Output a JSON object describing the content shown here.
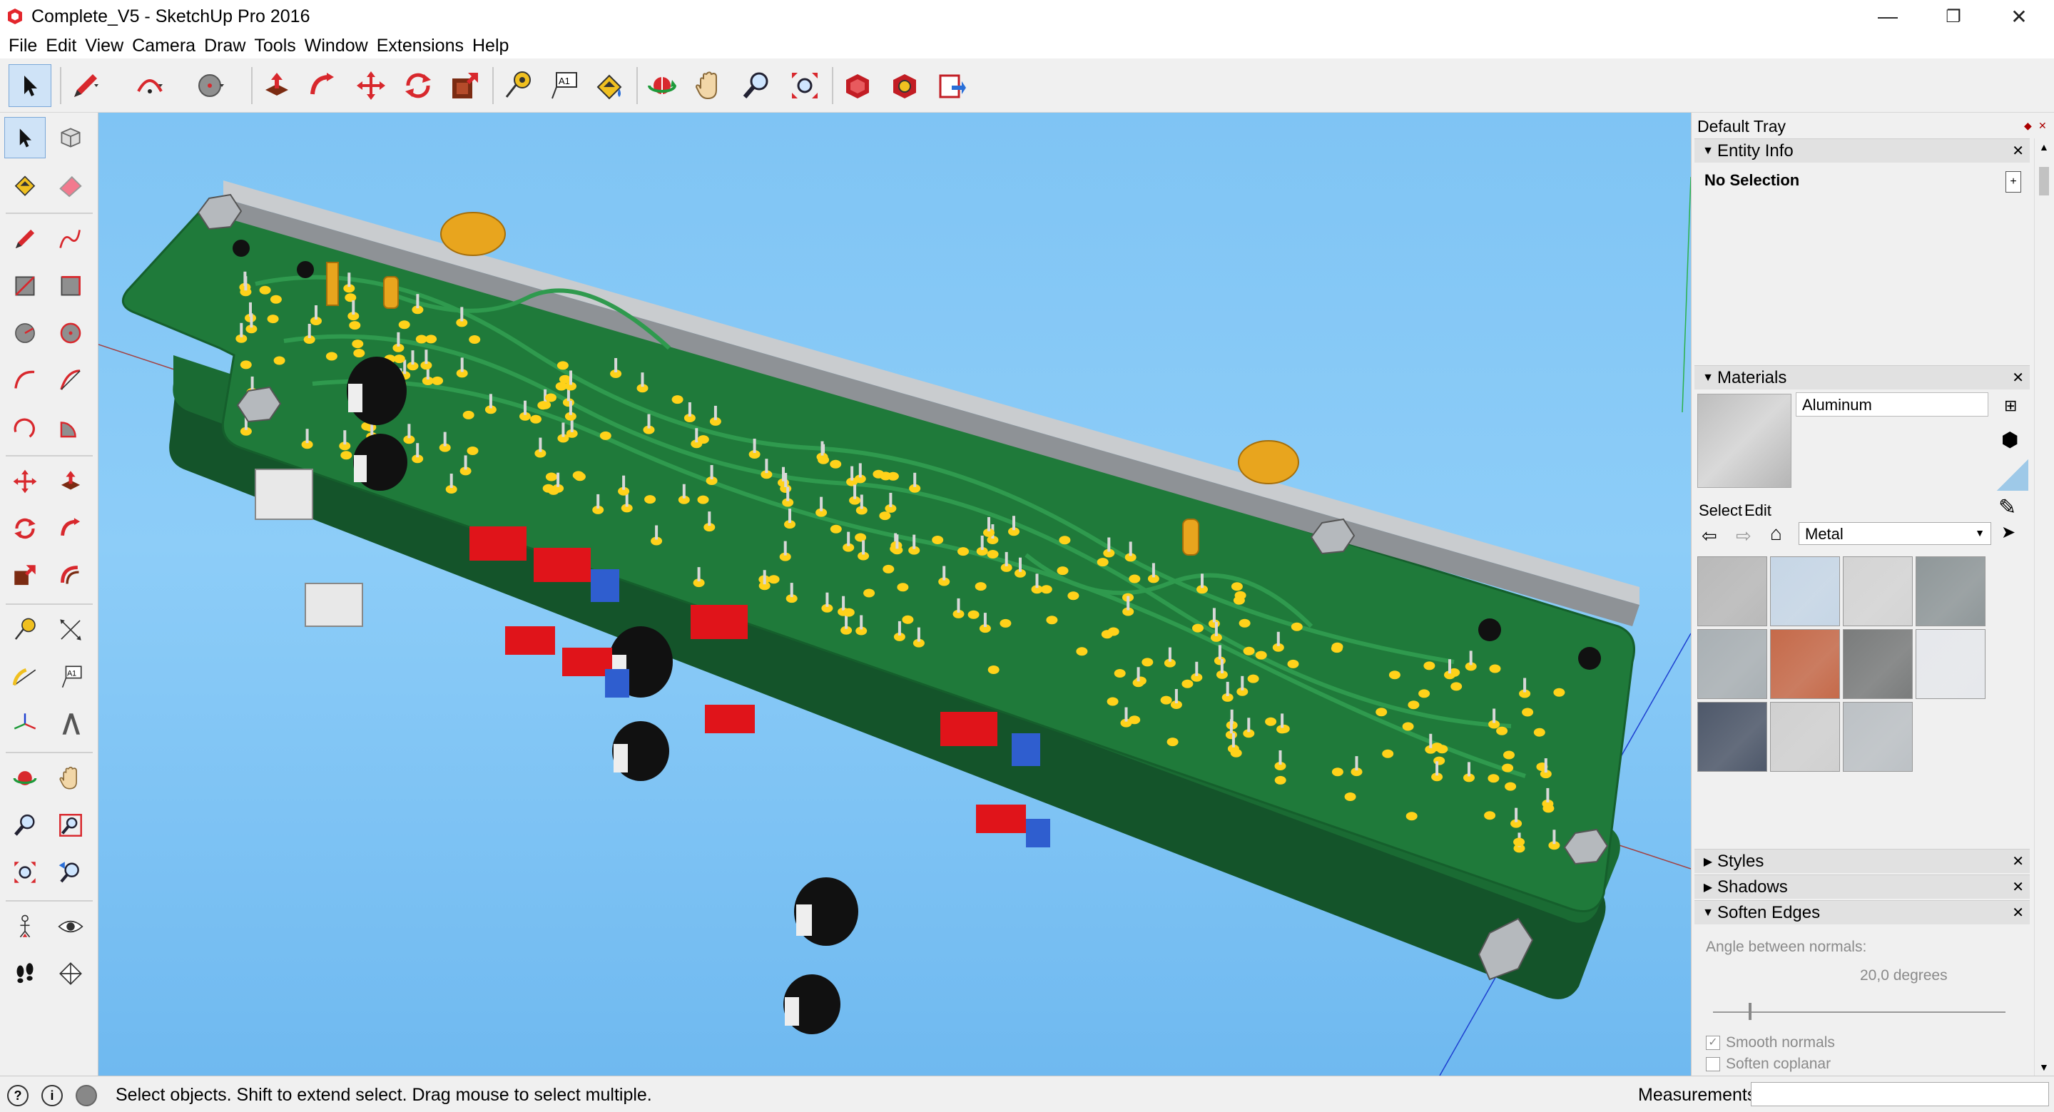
{
  "window": {
    "title": "Complete_V5 - SketchUp Pro 2016",
    "minimize": "—",
    "restore": "❐",
    "close": "✕"
  },
  "menu": [
    "File",
    "Edit",
    "View",
    "Camera",
    "Draw",
    "Tools",
    "Window",
    "Extensions",
    "Help"
  ],
  "toolbar_icons": [
    "select-icon",
    "pencil-icon",
    "arc-icon",
    "circle-icon",
    "push-pull-icon",
    "follow-me-icon",
    "move-icon",
    "rotate-icon",
    "offset-icon",
    "tape-measure-icon",
    "text-icon",
    "paint-bucket-icon",
    "orbit-icon",
    "pan-icon",
    "zoom-icon",
    "zoom-extents-icon",
    "3d-warehouse-icon",
    "extension-warehouse-icon",
    "layout-icon"
  ],
  "tray": {
    "title": "Default Tray",
    "entity_info": {
      "label": "Entity Info",
      "selection": "No Selection"
    },
    "materials": {
      "label": "Materials",
      "current": "Aluminum",
      "tab_select": "Select",
      "tab_edit": "Edit",
      "library": "Metal",
      "swatch_colors": [
        "#b9b9b9",
        "#c6d6e6",
        "#d4d4d4",
        "#8f9799",
        "#a9b0b4",
        "#c56a4a",
        "#7a7c7c",
        "#e6e8ec",
        "#4e586a",
        "#d0d0d0",
        "#bcc1c5"
      ]
    },
    "styles": {
      "label": "Styles"
    },
    "shadows": {
      "label": "Shadows"
    },
    "soften_edges": {
      "label": "Soften Edges",
      "angle_label": "Angle between normals:",
      "angle_value": "20,0  degrees",
      "smooth_normals": "Smooth normals",
      "soften_coplanar": "Soften coplanar"
    }
  },
  "status": {
    "text": "Select objects. Shift to extend select. Drag mouse to select multiple.",
    "measurements_label": "Measurements"
  },
  "colors": {
    "sky": "#86c8f6",
    "pcb": "#1f7a3a",
    "pcb_dark": "#14542a",
    "pad": "#ffd21a",
    "rail": "#b9bcbf",
    "red_button": "#e0141a",
    "blue_trim": "#2f5ecf"
  }
}
